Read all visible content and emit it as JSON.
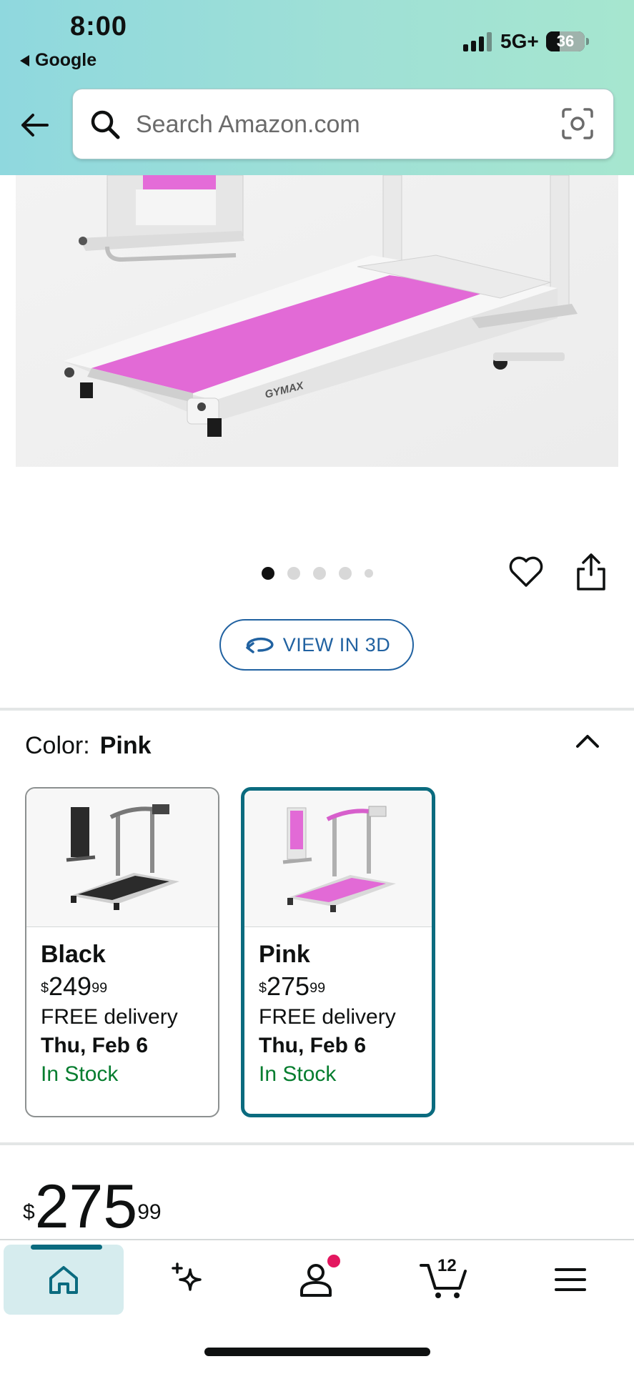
{
  "status_bar": {
    "time": "8:00",
    "back_app": "Google",
    "network": "5G+",
    "battery": "36"
  },
  "search": {
    "placeholder": "Search Amazon.com"
  },
  "product": {
    "brand_on_image": "GYMAX",
    "image_dots": 5,
    "active_dot": 1,
    "view_3d_label": "VIEW IN 3D"
  },
  "color_selector": {
    "label": "Color:",
    "selected": "Pink",
    "options": [
      {
        "name": "Black",
        "price_whole": "249",
        "price_cents": "99",
        "delivery": "FREE delivery",
        "date": "Thu, Feb 6",
        "stock": "In Stock",
        "selected": false
      },
      {
        "name": "Pink",
        "price_whole": "275",
        "price_cents": "99",
        "delivery": "FREE delivery",
        "date": "Thu, Feb 6",
        "stock": "In Stock",
        "selected": true
      }
    ]
  },
  "price": {
    "currency": "$",
    "whole": "275",
    "cents": "99"
  },
  "bottom_nav": {
    "cart_count": "12",
    "active_tab": "home"
  },
  "colors": {
    "accent_teal": "#0b6b7f",
    "link_blue": "#2162a1",
    "in_stock_green": "#067d2f",
    "belt_pink": "#e26ad6",
    "notification_red": "#e3175f"
  }
}
